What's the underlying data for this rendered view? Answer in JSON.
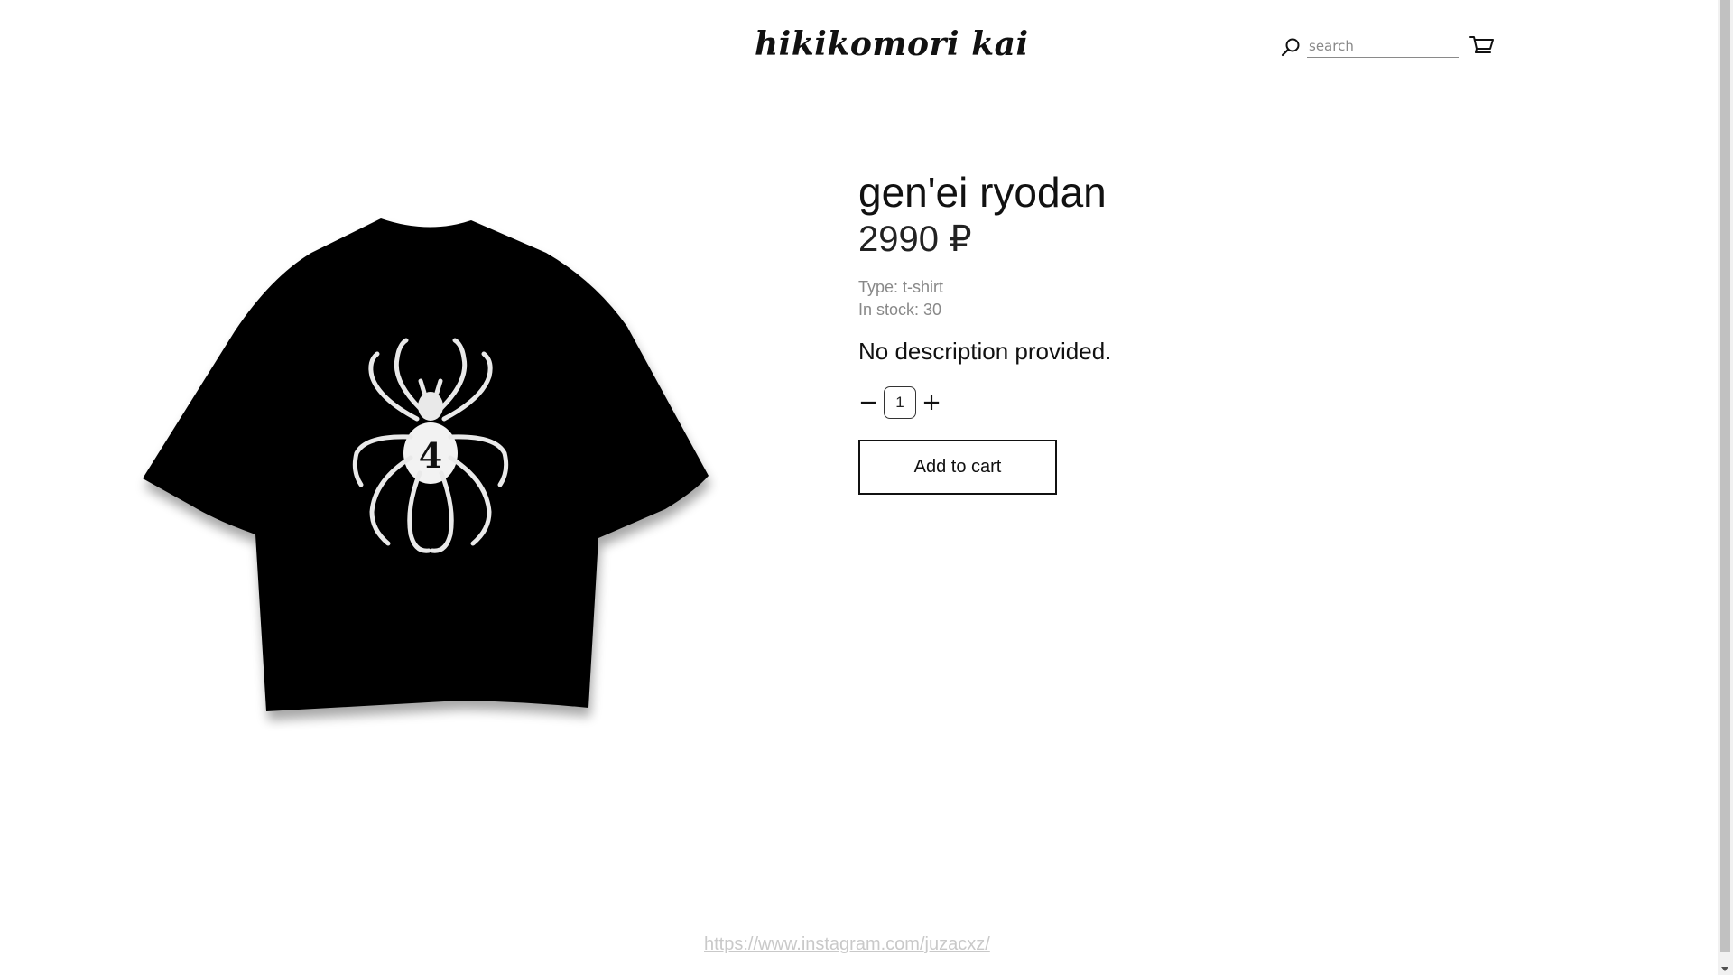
{
  "header": {
    "logo_text": "hikikomori kai",
    "search_placeholder": "search"
  },
  "product": {
    "title": "gen'ei ryodan",
    "price": "2990 ₽",
    "type_line": "Type: t-shirt",
    "stock_line": "In stock: 30",
    "description": "No description provided.",
    "quantity": "1",
    "minus_label": "−",
    "plus_label": "+",
    "add_to_cart_label": "Add to cart",
    "print_number": "4"
  },
  "footer": {
    "link_text": "https://www.instagram.com/juzacxz/"
  },
  "icons": {
    "search": "search-icon",
    "cart": "cart-icon"
  }
}
